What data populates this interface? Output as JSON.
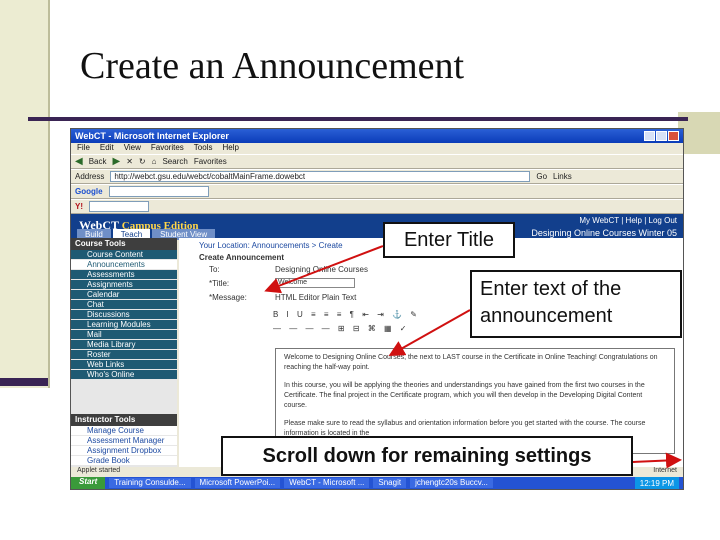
{
  "slide": {
    "title": "Create an Announcement"
  },
  "browser": {
    "window_title": "WebCT - Microsoft Internet Explorer",
    "menu": [
      "File",
      "Edit",
      "View",
      "Favorites",
      "Tools",
      "Help"
    ],
    "toolbar": {
      "back": "Back",
      "search": "Search",
      "favorites": "Favorites"
    },
    "address_label": "Address",
    "address_value": "http://webct.gsu.edu/webct/cobaltMainFrame.dowebct",
    "go_label": "Go",
    "google_label": "Google",
    "links_label": "Links",
    "status_text": "Applet started",
    "zone": "Internet"
  },
  "webct": {
    "logo_text": "WebCT",
    "logo_edition": "Campus Edition",
    "top_right": "My WebCT | Help | Log Out",
    "course_name": "Designing Online Courses Winter 05",
    "tabs": [
      "Build",
      "Teach",
      "Student View"
    ],
    "breadcrumb": "Your Location: Announcements > Create",
    "page_heading": "Create Announcement",
    "form": {
      "to_label": "To:",
      "to_value": "Designing Online Courses",
      "title_label": "*Title:",
      "title_value": "Welcome",
      "message_label": "*Message:",
      "format_options": "HTML Editor  Plain Text"
    },
    "editor_toolbar_1": "B I U  ≡ ≡ ≡  ¶ ⇤ ⇥  ⚓ ✎",
    "editor_toolbar_2": "— — — — ⊞ ⊟ ⌘ ▦ ✓",
    "message_p1": "Welcome to Designing Online Courses, the next to LAST course in the Certificate in Online Teaching! Congratulations on reaching the half-way point.",
    "message_p2": "In this course, you will be applying the theories and understandings you have gained from the first two courses in the Certificate. The final project in the Certificate program, which you will then develop in the Developing Digital Content course.",
    "message_p3": "Please make sure to read the syllabus and orientation information before you get started with the course. The course information is located in the",
    "course_tools_header": "Course Tools",
    "course_tools": [
      "Course Content",
      "Announcements",
      "Assessments",
      "Assignments",
      "Calendar",
      "Chat",
      "Discussions",
      "Learning Modules",
      "Mail",
      "Media Library",
      "Roster",
      "Web Links",
      "Who's Online"
    ],
    "instructor_tools_header": "Instructor Tools",
    "instructor_tools": [
      "Manage Course",
      "Assessment Manager",
      "Assignment Dropbox",
      "Grade Book"
    ]
  },
  "taskbar": {
    "start": "Start",
    "tasks": [
      "Training Consulde...",
      "Microsoft PowerPoi...",
      "WebCT - Microsoft ...",
      "Snagit",
      "jchengtc20s Buccv..."
    ],
    "clock": "12:19 PM"
  },
  "callouts": {
    "enter_title": "Enter Title",
    "enter_text": "Enter text of the announcement",
    "scroll_down": "Scroll down for remaining settings"
  },
  "colors": {
    "accent_dark": "#3a2454",
    "webct_blue": "#123f8c",
    "arrow_red": "#d01010",
    "sidebar_teal": "#1f5a73"
  }
}
